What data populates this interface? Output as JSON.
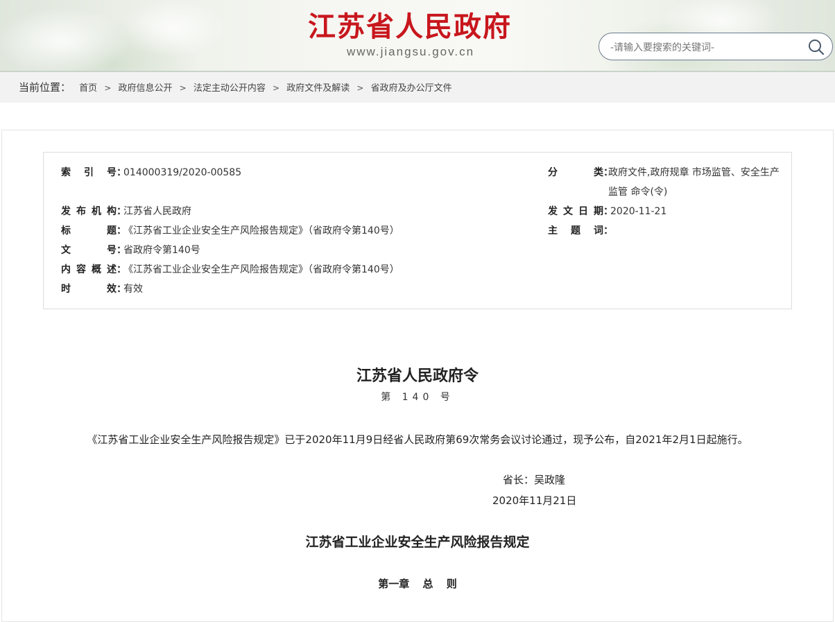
{
  "header": {
    "site_title": "江苏省人民政府",
    "site_domain": "www.jiangsu.gov.cn",
    "search_placeholder": "-请输入要搜索的关键词-"
  },
  "breadcrumb": {
    "lead": "当前位置：",
    "items": [
      "首页",
      "政府信息公开",
      "法定主动公开内容",
      "政府文件及解读",
      "省政府及办公厅文件"
    ],
    "separator": ">"
  },
  "meta": {
    "index_label": "索 引 号",
    "index_value": "014000319/2020-00585",
    "category_label": "分　　类",
    "category_value": "政府文件,政府规章 市场监管、安全生产监管 命令(令)",
    "publisher_label": "发布机构",
    "publisher_value": "江苏省人民政府",
    "date_label": "发文日期",
    "date_value": "2020-11-21",
    "title_label": "标　　题",
    "title_value": "《江苏省工业企业安全生产风险报告规定》（省政府令第140号）",
    "keyword_label": "主 题 词",
    "keyword_value": "",
    "docno_label": "文　　号",
    "docno_value": "省政府令第140号",
    "summary_label": "内容概述",
    "summary_value": "《江苏省工业企业安全生产风险报告规定》（省政府令第140号）",
    "validity_label": "时　　效",
    "validity_value": "有效",
    "colon": "："
  },
  "document": {
    "title": "江苏省人民政府令",
    "number": "第 140 号",
    "paragraph": "《江苏省工业企业安全生产风险报告规定》已于2020年11月9日经省人民政府第69次常务会议讨论通过，现予公布，自2021年2月1日起施行。",
    "signer": "省长：吴政隆",
    "date": "2020年11月21日",
    "rule_title": "江苏省工业企业安全生产风险报告规定",
    "chapter_title": "第一章 总 则"
  },
  "colors": {
    "brand_red": "#c8161d",
    "breadcrumb_bg": "#f2f2f2",
    "border": "#dcdcdc"
  }
}
